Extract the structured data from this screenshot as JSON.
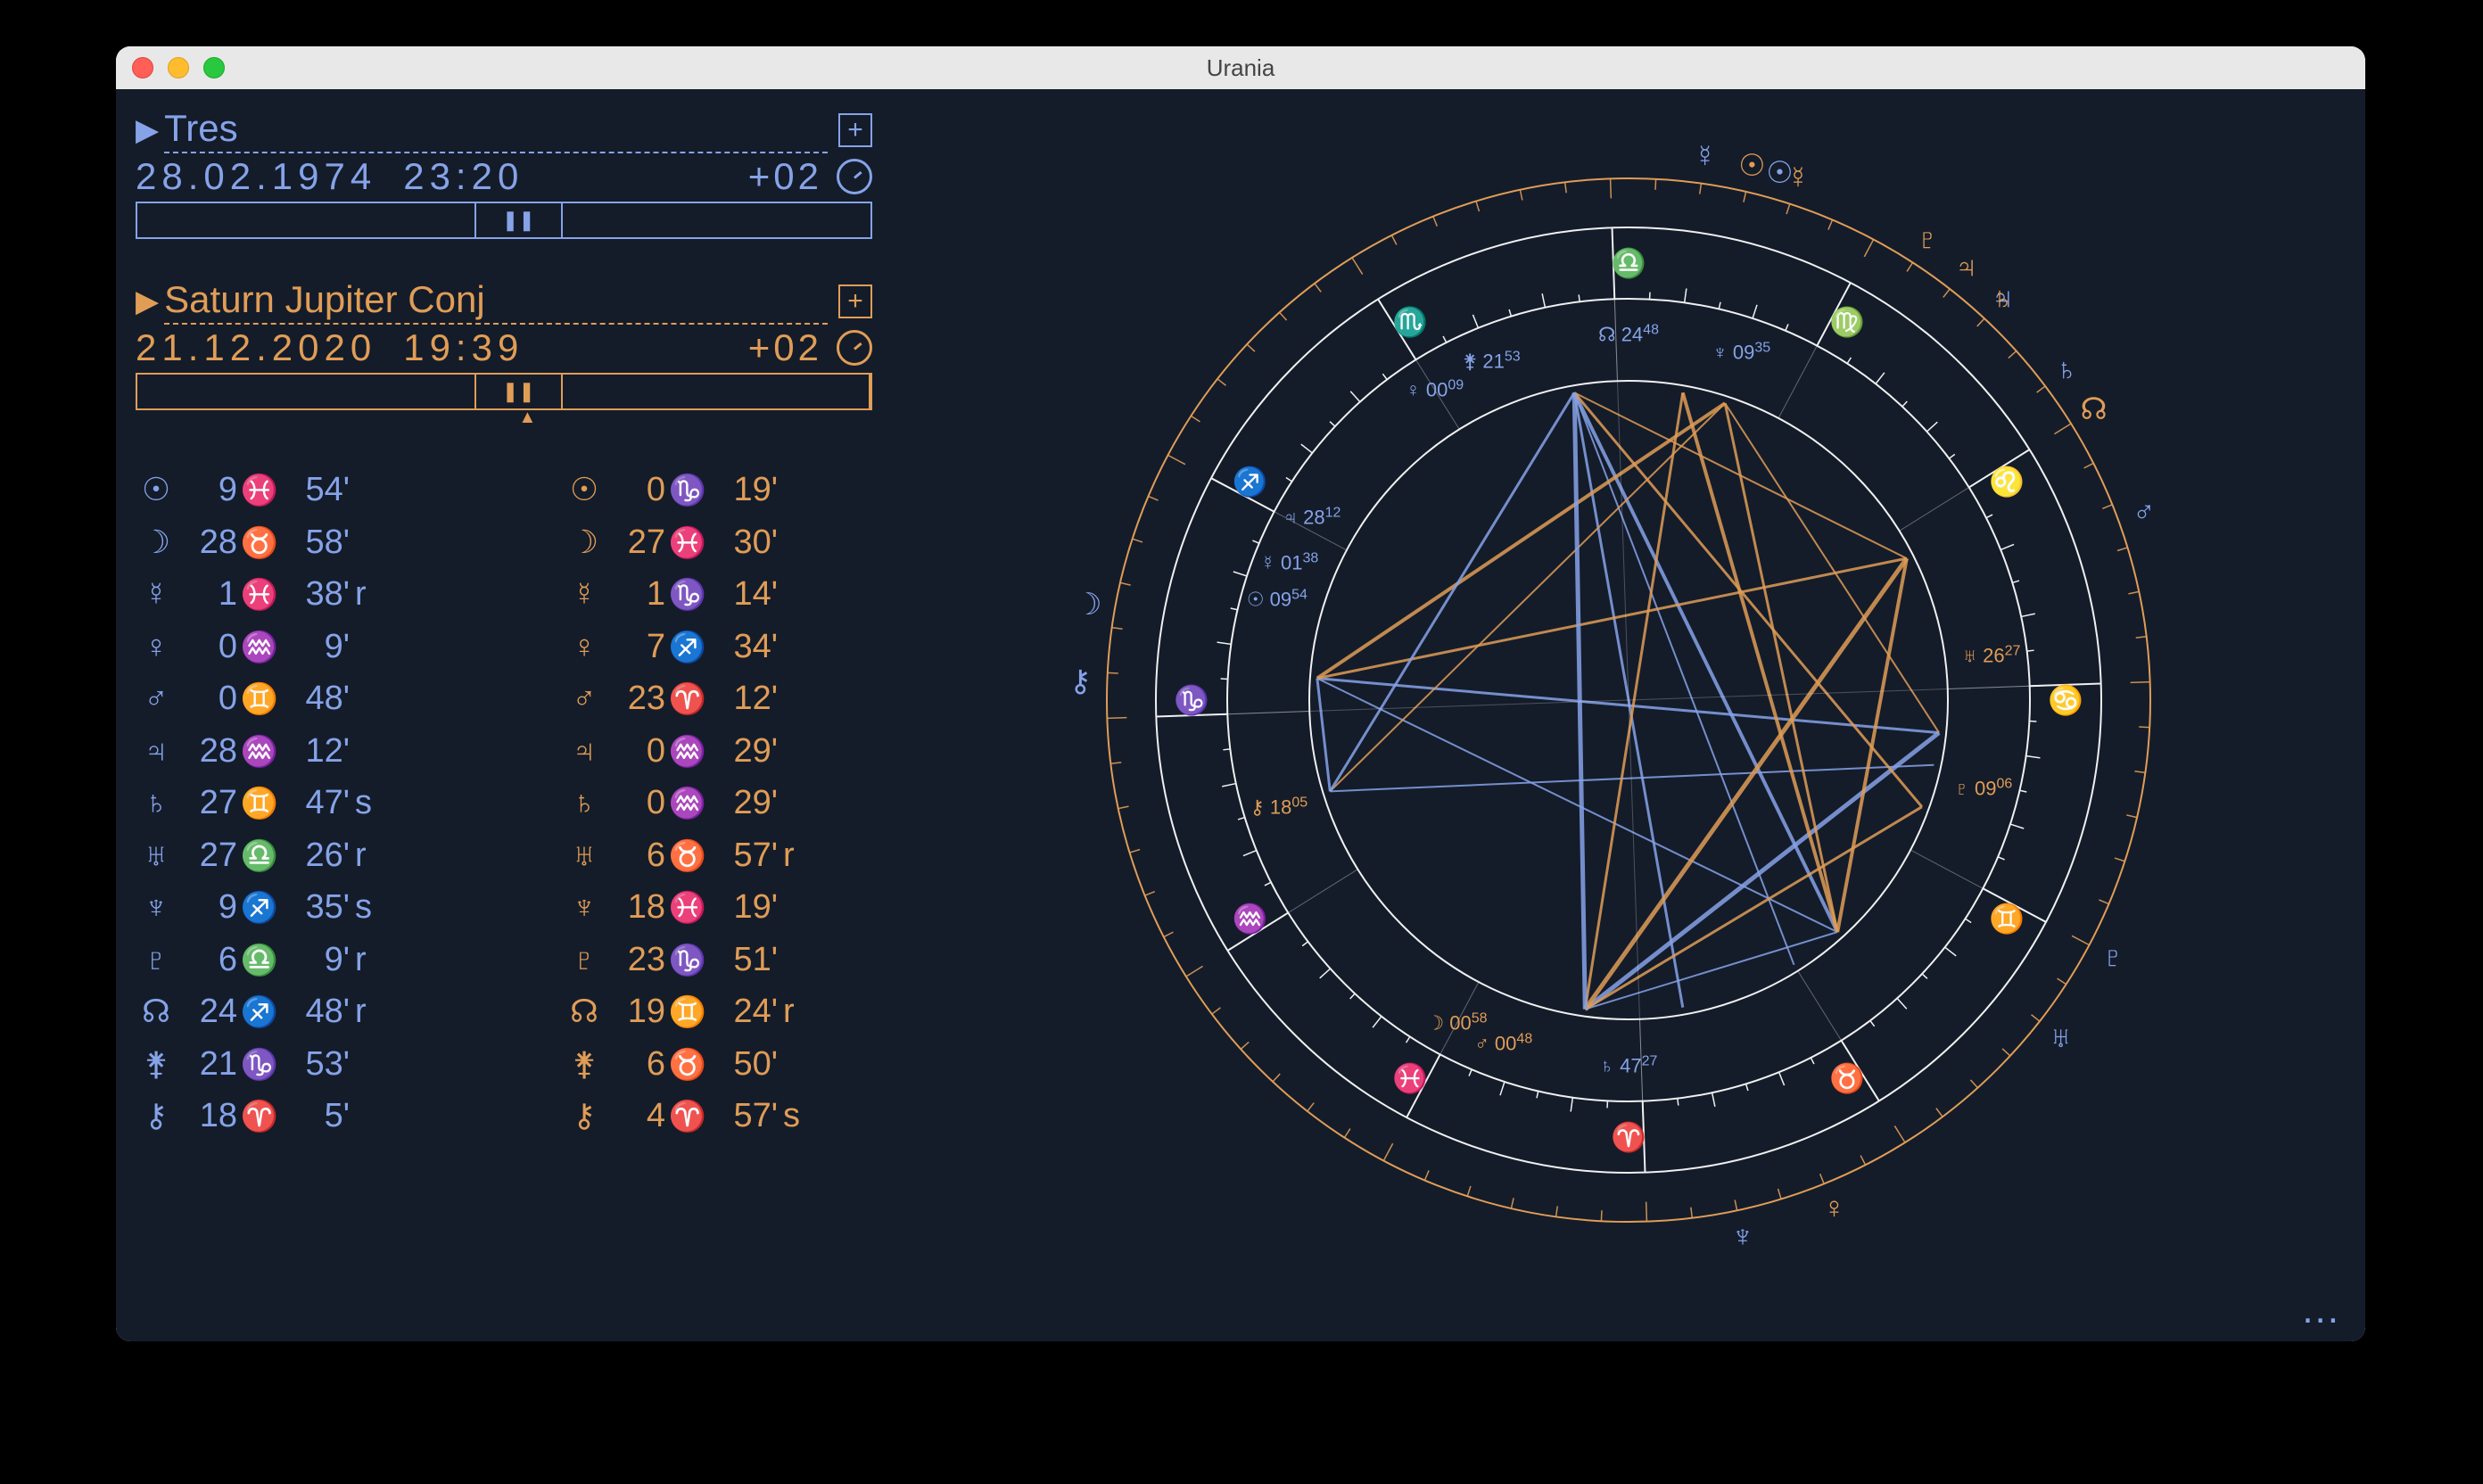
{
  "window": {
    "title": "Urania"
  },
  "colors": {
    "blue": "#86a3e8",
    "orange": "#e09d56",
    "bg": "#141c2a",
    "ring": "#f0f0f0"
  },
  "charts": [
    {
      "id": "natal",
      "color": "blue",
      "name": "Tres",
      "date": "28.02.1974",
      "time": "23:20",
      "tz": "+02",
      "playback": "pause"
    },
    {
      "id": "transit",
      "color": "orange",
      "name": "Saturn Jupiter Conj",
      "date": "21.12.2020",
      "time": "19:39",
      "tz": "+02",
      "playback": "pause",
      "caret": true
    }
  ],
  "positions": {
    "natal": [
      {
        "g": "☉",
        "d": "9",
        "s": "♓",
        "m": "54'",
        "f": ""
      },
      {
        "g": "☽",
        "d": "28",
        "s": "♉",
        "m": "58'",
        "f": ""
      },
      {
        "g": "☿",
        "d": "1",
        "s": "♓",
        "m": "38'",
        "f": "r"
      },
      {
        "g": "♀",
        "d": "0",
        "s": "♒",
        "m": "9'",
        "f": ""
      },
      {
        "g": "♂",
        "d": "0",
        "s": "♊",
        "m": "48'",
        "f": ""
      },
      {
        "g": "♃",
        "d": "28",
        "s": "♒",
        "m": "12'",
        "f": ""
      },
      {
        "g": "♄",
        "d": "27",
        "s": "♊",
        "m": "47'",
        "f": "s"
      },
      {
        "g": "♅",
        "d": "27",
        "s": "♎",
        "m": "26'",
        "f": "r"
      },
      {
        "g": "♆",
        "d": "9",
        "s": "♐",
        "m": "35'",
        "f": "s"
      },
      {
        "g": "♇",
        "d": "6",
        "s": "♎",
        "m": "9'",
        "f": "r"
      },
      {
        "g": "☊",
        "d": "24",
        "s": "♐",
        "m": "48'",
        "f": "r"
      },
      {
        "g": "⚵",
        "d": "21",
        "s": "♑",
        "m": "53'",
        "f": ""
      },
      {
        "g": "⚷",
        "d": "18",
        "s": "♈",
        "m": "5'",
        "f": ""
      }
    ],
    "transit": [
      {
        "g": "☉",
        "d": "0",
        "s": "♑",
        "m": "19'",
        "f": ""
      },
      {
        "g": "☽",
        "d": "27",
        "s": "♓",
        "m": "30'",
        "f": ""
      },
      {
        "g": "☿",
        "d": "1",
        "s": "♑",
        "m": "14'",
        "f": ""
      },
      {
        "g": "♀",
        "d": "7",
        "s": "♐",
        "m": "34'",
        "f": ""
      },
      {
        "g": "♂",
        "d": "23",
        "s": "♈",
        "m": "12'",
        "f": ""
      },
      {
        "g": "♃",
        "d": "0",
        "s": "♒",
        "m": "29'",
        "f": ""
      },
      {
        "g": "♄",
        "d": "0",
        "s": "♒",
        "m": "29'",
        "f": ""
      },
      {
        "g": "♅",
        "d": "6",
        "s": "♉",
        "m": "57'",
        "f": "r"
      },
      {
        "g": "♆",
        "d": "18",
        "s": "♓",
        "m": "19'",
        "f": ""
      },
      {
        "g": "♇",
        "d": "23",
        "s": "♑",
        "m": "51'",
        "f": ""
      },
      {
        "g": "☊",
        "d": "19",
        "s": "♊",
        "m": "24'",
        "f": "r"
      },
      {
        "g": "⚵",
        "d": "6",
        "s": "♉",
        "m": "50'",
        "f": ""
      },
      {
        "g": "⚷",
        "d": "4",
        "s": "♈",
        "m": "57'",
        "f": "s"
      }
    ]
  },
  "zodiac_signs": [
    "♓",
    "♒",
    "♑",
    "♐",
    "♏",
    "♎",
    "♍",
    "♌",
    "♋",
    "♊",
    "♉",
    "♈"
  ],
  "wheel": {
    "asc_deg": 178,
    "outer_planets": {
      "natal": [
        {
          "g": "☽",
          "a": 178
        },
        {
          "g": "⚷",
          "a": 186
        },
        {
          "g": "♂",
          "a": 28
        },
        {
          "g": "♇",
          "a": 340
        },
        {
          "g": "♅",
          "a": 330
        },
        {
          "g": "♆",
          "a": 290
        },
        {
          "g": "♄",
          "a": 45
        },
        {
          "g": "♃",
          "a": 55
        },
        {
          "g": "☉",
          "a": 82
        },
        {
          "g": "☿",
          "a": 90
        }
      ],
      "transit": [
        {
          "g": "♀",
          "a": 300
        },
        {
          "g": "☊",
          "a": 40
        },
        {
          "g": "♄",
          "a": 55
        },
        {
          "g": "♃",
          "a": 60
        },
        {
          "g": "♇",
          "a": 65
        },
        {
          "g": "☉",
          "a": 85
        },
        {
          "g": "☿",
          "a": 80
        }
      ]
    },
    "inner_labels": [
      {
        "c": "blue",
        "t": "♀",
        "d": "00",
        "m": "09",
        "a": 130
      },
      {
        "c": "blue",
        "t": "⚵",
        "d": "21",
        "m": "53",
        "a": 120
      },
      {
        "c": "blue",
        "t": "☊",
        "d": "24",
        "m": "48",
        "a": 98
      },
      {
        "c": "blue",
        "t": "♆",
        "d": "09",
        "m": "35",
        "a": 80
      },
      {
        "c": "blue",
        "t": "♃",
        "d": "28",
        "m": "12",
        "a": 158
      },
      {
        "c": "blue",
        "t": "☿",
        "d": "01",
        "m": "38",
        "a": 166
      },
      {
        "c": "blue",
        "t": "☉",
        "d": "09",
        "m": "54",
        "a": 172
      },
      {
        "c": "orange",
        "t": "⚷",
        "d": "18",
        "m": "05",
        "a": 205
      },
      {
        "c": "orange",
        "t": "☽",
        "d": "00",
        "m": "58",
        "a": 250
      },
      {
        "c": "orange",
        "t": "♂",
        "d": "00",
        "m": "48",
        "a": 258
      },
      {
        "c": "blue",
        "t": "♄",
        "d": "47",
        "m": "27",
        "a": 278
      },
      {
        "c": "orange",
        "t": "♇",
        "d": "09",
        "m": "06",
        "a": 354
      },
      {
        "c": "orange",
        "t": "♅",
        "d": "26",
        "m": "27",
        "a": 15
      }
    ],
    "aspects": [
      {
        "a": 130,
        "b": 278,
        "c": "blue",
        "w": 4
      },
      {
        "a": 130,
        "b": 354,
        "c": "blue",
        "w": 2
      },
      {
        "a": 130,
        "b": 80,
        "c": "blue",
        "w": 2
      },
      {
        "a": 120,
        "b": 278,
        "c": "blue",
        "w": 2
      },
      {
        "a": 98,
        "b": 278,
        "c": "blue",
        "w": 3
      },
      {
        "a": 166,
        "b": 15,
        "c": "blue",
        "w": 2
      },
      {
        "a": 172,
        "b": 80,
        "c": "blue",
        "w": 5
      },
      {
        "a": 172,
        "b": 354,
        "c": "blue",
        "w": 3
      },
      {
        "a": 158,
        "b": 278,
        "c": "orange",
        "w": 3
      },
      {
        "a": 158,
        "b": 80,
        "c": "orange",
        "w": 3
      },
      {
        "a": 205,
        "b": 130,
        "c": "orange",
        "w": 4
      },
      {
        "a": 205,
        "b": 80,
        "c": "orange",
        "w": 5
      },
      {
        "a": 205,
        "b": 354,
        "c": "orange",
        "w": 3
      },
      {
        "a": 205,
        "b": 278,
        "c": "orange",
        "w": 2
      },
      {
        "a": 250,
        "b": 130,
        "c": "orange",
        "w": 3
      },
      {
        "a": 250,
        "b": 172,
        "c": "orange",
        "w": 2
      },
      {
        "a": 250,
        "b": 354,
        "c": "orange",
        "w": 4
      },
      {
        "a": 250,
        "b": 15,
        "c": "orange",
        "w": 2
      },
      {
        "a": 258,
        "b": 130,
        "c": "orange",
        "w": 4
      },
      {
        "a": 258,
        "b": 80,
        "c": "orange",
        "w": 3
      },
      {
        "a": 278,
        "b": 15,
        "c": "blue",
        "w": 3
      },
      {
        "a": 278,
        "b": 80,
        "c": "blue",
        "w": 5
      },
      {
        "a": 354,
        "b": 15,
        "c": "blue",
        "w": 3
      }
    ]
  },
  "more": "..."
}
